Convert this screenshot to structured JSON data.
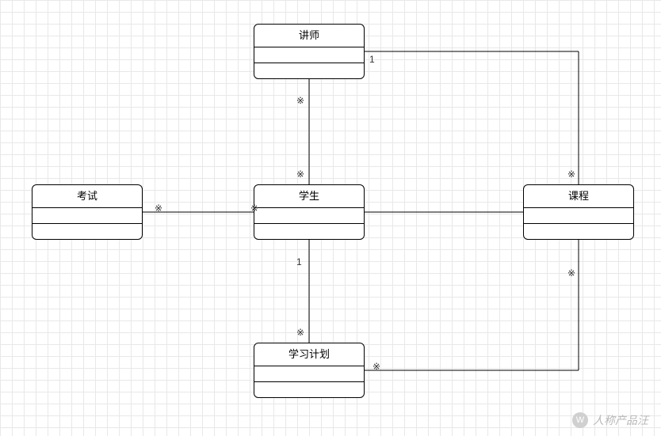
{
  "entities": {
    "instructor": {
      "label": "讲师"
    },
    "exam": {
      "label": "考试"
    },
    "student": {
      "label": "学生"
    },
    "course": {
      "label": "课程"
    },
    "studyPlan": {
      "label": "学习计划"
    }
  },
  "multiplicities": {
    "instructor_course": "1",
    "instructor_student_top": "※",
    "instructor_student_bottom": "※",
    "exam_student_left": "※",
    "exam_student_right": "※",
    "student_plan_top": "1",
    "student_plan_bottom": "※",
    "course_plan_top": "※",
    "course_plan_bottom": "※",
    "course_instructor": "※"
  },
  "watermark": {
    "icon": "W",
    "text": "人称产品汪"
  },
  "chart_data": {
    "type": "uml-class-diagram",
    "classes": [
      {
        "id": "instructor",
        "name": "讲师",
        "attributes": [],
        "operations": []
      },
      {
        "id": "exam",
        "name": "考试",
        "attributes": [],
        "operations": []
      },
      {
        "id": "student",
        "name": "学生",
        "attributes": [],
        "operations": []
      },
      {
        "id": "course",
        "name": "课程",
        "attributes": [],
        "operations": []
      },
      {
        "id": "studyPlan",
        "name": "学习计划",
        "attributes": [],
        "operations": []
      }
    ],
    "associations": [
      {
        "from": "instructor",
        "to": "student",
        "from_mult": "※",
        "to_mult": "※"
      },
      {
        "from": "instructor",
        "to": "course",
        "from_mult": "1",
        "to_mult": "※"
      },
      {
        "from": "student",
        "to": "exam",
        "from_mult": "※",
        "to_mult": "※"
      },
      {
        "from": "student",
        "to": "course",
        "from_mult": "",
        "to_mult": ""
      },
      {
        "from": "student",
        "to": "studyPlan",
        "from_mult": "1",
        "to_mult": "※"
      },
      {
        "from": "course",
        "to": "studyPlan",
        "from_mult": "※",
        "to_mult": "※"
      }
    ]
  }
}
